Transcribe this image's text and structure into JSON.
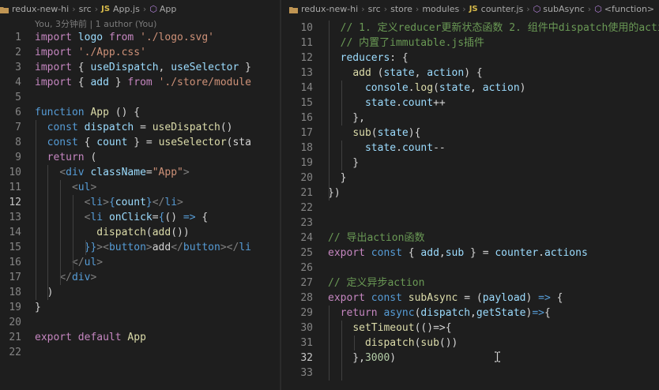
{
  "left_editor": {
    "breadcrumb": [
      "redux-new-hi",
      "src",
      "App.js",
      "App"
    ],
    "file_badge": "JS",
    "blame": "You, 3分钟前 | 1 author (You)",
    "line_numbers": [
      "1",
      "2",
      "3",
      "4",
      "5",
      "6",
      "7",
      "8",
      "9",
      "10",
      "11",
      "12",
      "13",
      "14",
      "15",
      "16",
      "17",
      "18",
      "19",
      "20",
      "21",
      "22"
    ],
    "active_line": "12",
    "lines": [
      [
        {
          "t": "import",
          "c": "c"
        },
        {
          "t": " ",
          "c": "p"
        },
        {
          "t": "logo",
          "c": "v"
        },
        {
          "t": " ",
          "c": "p"
        },
        {
          "t": "from",
          "c": "c"
        },
        {
          "t": " ",
          "c": "p"
        },
        {
          "t": "'./logo.svg'",
          "c": "s"
        }
      ],
      [
        {
          "t": "import",
          "c": "c"
        },
        {
          "t": " ",
          "c": "p"
        },
        {
          "t": "'./App.css'",
          "c": "s"
        }
      ],
      [
        {
          "t": "import",
          "c": "c"
        },
        {
          "t": " { ",
          "c": "p"
        },
        {
          "t": "useDispatch",
          "c": "v"
        },
        {
          "t": ", ",
          "c": "p"
        },
        {
          "t": "useSelector",
          "c": "v"
        },
        {
          "t": " }",
          "c": "p"
        }
      ],
      [
        {
          "t": "import",
          "c": "c"
        },
        {
          "t": " { ",
          "c": "p"
        },
        {
          "t": "add",
          "c": "v"
        },
        {
          "t": " } ",
          "c": "p"
        },
        {
          "t": "from",
          "c": "c"
        },
        {
          "t": " ",
          "c": "p"
        },
        {
          "t": "'./store/module",
          "c": "s"
        }
      ],
      [],
      [
        {
          "t": "function",
          "c": "k"
        },
        {
          "t": " ",
          "c": "p"
        },
        {
          "t": "App",
          "c": "f"
        },
        {
          "t": " () {",
          "c": "p"
        }
      ],
      [
        {
          "t": "  ",
          "c": "p"
        },
        {
          "t": "const",
          "c": "k"
        },
        {
          "t": " ",
          "c": "p"
        },
        {
          "t": "dispatch",
          "c": "v"
        },
        {
          "t": " = ",
          "c": "p"
        },
        {
          "t": "useDispatch",
          "c": "f"
        },
        {
          "t": "()",
          "c": "p"
        }
      ],
      [
        {
          "t": "  ",
          "c": "p"
        },
        {
          "t": "const",
          "c": "k"
        },
        {
          "t": " { ",
          "c": "p"
        },
        {
          "t": "count",
          "c": "v"
        },
        {
          "t": " } = ",
          "c": "p"
        },
        {
          "t": "useSelector",
          "c": "f"
        },
        {
          "t": "(sta",
          "c": "p"
        }
      ],
      [
        {
          "t": "  ",
          "c": "p"
        },
        {
          "t": "return",
          "c": "c"
        },
        {
          "t": " (",
          "c": "p"
        }
      ],
      [
        {
          "t": "    ",
          "c": "p"
        },
        {
          "t": "<",
          "c": "tg"
        },
        {
          "t": "div",
          "c": "tn"
        },
        {
          "t": " ",
          "c": "p"
        },
        {
          "t": "className",
          "c": "v"
        },
        {
          "t": "=",
          "c": "p"
        },
        {
          "t": "\"App\"",
          "c": "s"
        },
        {
          "t": ">",
          "c": "tg"
        }
      ],
      [
        {
          "t": "      ",
          "c": "p"
        },
        {
          "t": "<",
          "c": "tg"
        },
        {
          "t": "ul",
          "c": "tn"
        },
        {
          "t": ">",
          "c": "tg"
        }
      ],
      [
        {
          "t": "        ",
          "c": "p"
        },
        {
          "t": "<",
          "c": "tg"
        },
        {
          "t": "li",
          "c": "tn"
        },
        {
          "t": ">",
          "c": "tg"
        },
        {
          "t": "{",
          "c": "k"
        },
        {
          "t": "count",
          "c": "v"
        },
        {
          "t": "}",
          "c": "k"
        },
        {
          "t": "</",
          "c": "tg"
        },
        {
          "t": "li",
          "c": "tn"
        },
        {
          "t": ">",
          "c": "tg"
        }
      ],
      [
        {
          "t": "        ",
          "c": "p"
        },
        {
          "t": "<",
          "c": "tg"
        },
        {
          "t": "li",
          "c": "tn"
        },
        {
          "t": " ",
          "c": "p"
        },
        {
          "t": "onClick",
          "c": "v"
        },
        {
          "t": "=",
          "c": "p"
        },
        {
          "t": "{",
          "c": "k"
        },
        {
          "t": "() ",
          "c": "p"
        },
        {
          "t": "=>",
          "c": "k"
        },
        {
          "t": " {",
          "c": "p"
        }
      ],
      [
        {
          "t": "          ",
          "c": "p"
        },
        {
          "t": "dispatch",
          "c": "f"
        },
        {
          "t": "(",
          "c": "p"
        },
        {
          "t": "add",
          "c": "f"
        },
        {
          "t": "())",
          "c": "p"
        }
      ],
      [
        {
          "t": "        ",
          "c": "p"
        },
        {
          "t": "}}",
          "c": "k"
        },
        {
          "t": ">",
          "c": "tg"
        },
        {
          "t": "<",
          "c": "tg"
        },
        {
          "t": "button",
          "c": "tn"
        },
        {
          "t": ">",
          "c": "tg"
        },
        {
          "t": "add",
          "c": "p"
        },
        {
          "t": "</",
          "c": "tg"
        },
        {
          "t": "button",
          "c": "tn"
        },
        {
          "t": ">",
          "c": "tg"
        },
        {
          "t": "</",
          "c": "tg"
        },
        {
          "t": "li",
          "c": "tn"
        }
      ],
      [
        {
          "t": "      ",
          "c": "p"
        },
        {
          "t": "</",
          "c": "tg"
        },
        {
          "t": "ul",
          "c": "tn"
        },
        {
          "t": ">",
          "c": "tg"
        }
      ],
      [
        {
          "t": "    ",
          "c": "p"
        },
        {
          "t": "</",
          "c": "tg"
        },
        {
          "t": "div",
          "c": "tn"
        },
        {
          "t": ">",
          "c": "tg"
        }
      ],
      [
        {
          "t": "  )",
          "c": "p"
        }
      ],
      [
        {
          "t": "}",
          "c": "p"
        }
      ],
      [],
      [
        {
          "t": "export",
          "c": "c"
        },
        {
          "t": " ",
          "c": "p"
        },
        {
          "t": "default",
          "c": "c"
        },
        {
          "t": " ",
          "c": "p"
        },
        {
          "t": "App",
          "c": "f"
        }
      ],
      []
    ]
  },
  "right_editor": {
    "breadcrumb": [
      "redux-new-hi",
      "src",
      "store",
      "modules",
      "counter.js",
      "subAsync",
      "<function>"
    ],
    "file_badge": "JS",
    "line_numbers": [
      "10",
      "11",
      "12",
      "13",
      "14",
      "15",
      "16",
      "17",
      "18",
      "19",
      "20",
      "21",
      "22",
      "23",
      "24",
      "25",
      "26",
      "27",
      "28",
      "29",
      "30",
      "31",
      "32",
      "33"
    ],
    "active_line": "32",
    "lines": [
      [
        {
          "t": "  ",
          "c": "p"
        },
        {
          "t": "// 1. 定义reducer更新状态函数 2. 组件中dispatch使用的actio",
          "c": "cm"
        }
      ],
      [
        {
          "t": "  ",
          "c": "p"
        },
        {
          "t": "// 内置了immutable.js插件",
          "c": "cm"
        }
      ],
      [
        {
          "t": "  ",
          "c": "p"
        },
        {
          "t": "reducers",
          "c": "v"
        },
        {
          "t": ": {",
          "c": "p"
        }
      ],
      [
        {
          "t": "    ",
          "c": "p"
        },
        {
          "t": "add",
          "c": "f"
        },
        {
          "t": " (",
          "c": "p"
        },
        {
          "t": "state",
          "c": "v"
        },
        {
          "t": ", ",
          "c": "p"
        },
        {
          "t": "action",
          "c": "v"
        },
        {
          "t": ") {",
          "c": "p"
        }
      ],
      [
        {
          "t": "      ",
          "c": "p"
        },
        {
          "t": "console",
          "c": "v"
        },
        {
          "t": ".",
          "c": "p"
        },
        {
          "t": "log",
          "c": "f"
        },
        {
          "t": "(",
          "c": "p"
        },
        {
          "t": "state",
          "c": "v"
        },
        {
          "t": ", ",
          "c": "p"
        },
        {
          "t": "action",
          "c": "v"
        },
        {
          "t": ")",
          "c": "p"
        }
      ],
      [
        {
          "t": "      ",
          "c": "p"
        },
        {
          "t": "state",
          "c": "v"
        },
        {
          "t": ".",
          "c": "p"
        },
        {
          "t": "count",
          "c": "v"
        },
        {
          "t": "++",
          "c": "p"
        }
      ],
      [
        {
          "t": "    },",
          "c": "p"
        }
      ],
      [
        {
          "t": "    ",
          "c": "p"
        },
        {
          "t": "sub",
          "c": "f"
        },
        {
          "t": "(",
          "c": "p"
        },
        {
          "t": "state",
          "c": "v"
        },
        {
          "t": "){",
          "c": "p"
        }
      ],
      [
        {
          "t": "      ",
          "c": "p"
        },
        {
          "t": "state",
          "c": "v"
        },
        {
          "t": ".",
          "c": "p"
        },
        {
          "t": "count",
          "c": "v"
        },
        {
          "t": "--",
          "c": "p"
        }
      ],
      [
        {
          "t": "    }",
          "c": "p"
        }
      ],
      [
        {
          "t": "  }",
          "c": "p"
        }
      ],
      [
        {
          "t": "})",
          "c": "p"
        }
      ],
      [],
      [],
      [
        {
          "t": "// 导出action函数",
          "c": "cm"
        }
      ],
      [
        {
          "t": "export",
          "c": "c"
        },
        {
          "t": " ",
          "c": "p"
        },
        {
          "t": "const",
          "c": "k"
        },
        {
          "t": " { ",
          "c": "p"
        },
        {
          "t": "add",
          "c": "v"
        },
        {
          "t": ",",
          "c": "p"
        },
        {
          "t": "sub",
          "c": "v"
        },
        {
          "t": " } = ",
          "c": "p"
        },
        {
          "t": "counter",
          "c": "v"
        },
        {
          "t": ".",
          "c": "p"
        },
        {
          "t": "actions",
          "c": "v"
        }
      ],
      [],
      [
        {
          "t": "// 定义异步action",
          "c": "cm"
        }
      ],
      [
        {
          "t": "export",
          "c": "c"
        },
        {
          "t": " ",
          "c": "p"
        },
        {
          "t": "const",
          "c": "k"
        },
        {
          "t": " ",
          "c": "p"
        },
        {
          "t": "subAsync",
          "c": "f"
        },
        {
          "t": " = (",
          "c": "p"
        },
        {
          "t": "payload",
          "c": "v"
        },
        {
          "t": ") ",
          "c": "p"
        },
        {
          "t": "=>",
          "c": "k"
        },
        {
          "t": " {",
          "c": "p"
        }
      ],
      [
        {
          "t": "  ",
          "c": "p"
        },
        {
          "t": "return",
          "c": "c"
        },
        {
          "t": " ",
          "c": "p"
        },
        {
          "t": "async",
          "c": "k"
        },
        {
          "t": "(",
          "c": "p"
        },
        {
          "t": "dispatch",
          "c": "v"
        },
        {
          "t": ",",
          "c": "p"
        },
        {
          "t": "getState",
          "c": "v"
        },
        {
          "t": ")",
          "c": "p"
        },
        {
          "t": "=>",
          "c": "k"
        },
        {
          "t": "{",
          "c": "p"
        }
      ],
      [
        {
          "t": "    ",
          "c": "p"
        },
        {
          "t": "setTimeout",
          "c": "f"
        },
        {
          "t": "(()=>{",
          "c": "p"
        }
      ],
      [
        {
          "t": "      ",
          "c": "p"
        },
        {
          "t": "dispatch",
          "c": "f"
        },
        {
          "t": "(",
          "c": "p"
        },
        {
          "t": "sub",
          "c": "f"
        },
        {
          "t": "())",
          "c": "p"
        }
      ],
      [
        {
          "t": "    },",
          "c": "p"
        },
        {
          "t": "3000",
          "c": "n"
        },
        {
          "t": ")",
          "c": "p"
        }
      ],
      []
    ]
  },
  "colors": {
    "background": "#1e1e1e",
    "line_number": "#858585",
    "active_line_number": "#c6c6c6",
    "comment": "#6a9955",
    "keyword": "#569cd6",
    "control": "#c586c0",
    "function": "#dcdcaa",
    "variable": "#9cdcfe",
    "string": "#ce9178"
  }
}
